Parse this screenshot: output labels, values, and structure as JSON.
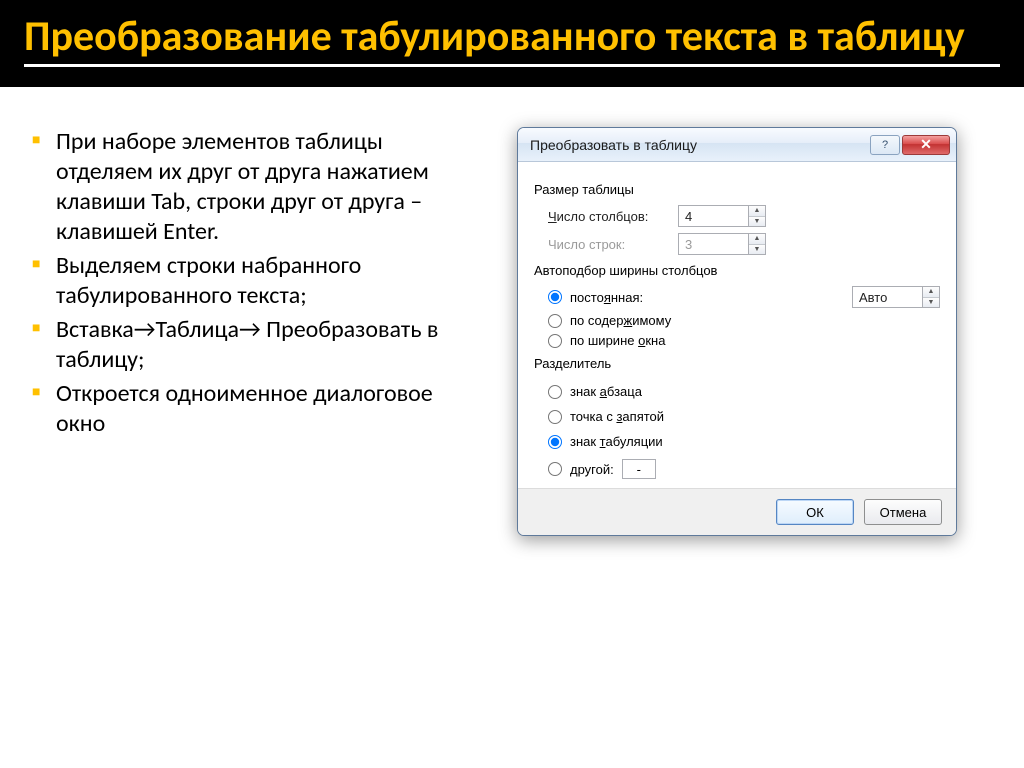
{
  "slide": {
    "title": "Преобразование табулированного текста в таблицу",
    "bullets": [
      "При наборе элементов таблицы отделяем их друг от друга нажатием клавиши Tab, строки друг от друга – клавишей Enter.",
      "Выделяем строки набранного табулированного текста;",
      "Вставка→Таблица→ Преобразовать в таблицу;",
      "Откроется одноименное диалоговое окно"
    ]
  },
  "dialog": {
    "title": "Преобразовать в таблицу",
    "size_group": "Размер таблицы",
    "cols_label": "Число столбцов:",
    "cols_value": "4",
    "rows_label": "Число строк:",
    "rows_value": "3",
    "autofit_group": "Автоподбор ширины столбцов",
    "autofit_fixed": "постоянная:",
    "autofit_fixed_value": "Авто",
    "autofit_content": "по содержимому",
    "autofit_window": "по ширине окна",
    "sep_group": "Разделитель",
    "sep_paragraph": "знак абзаца",
    "sep_semicolon": "точка с запятой",
    "sep_tab": "знак табуляции",
    "sep_other": "другой:",
    "sep_other_value": "-",
    "ok": "ОК",
    "cancel": "Отмена"
  }
}
